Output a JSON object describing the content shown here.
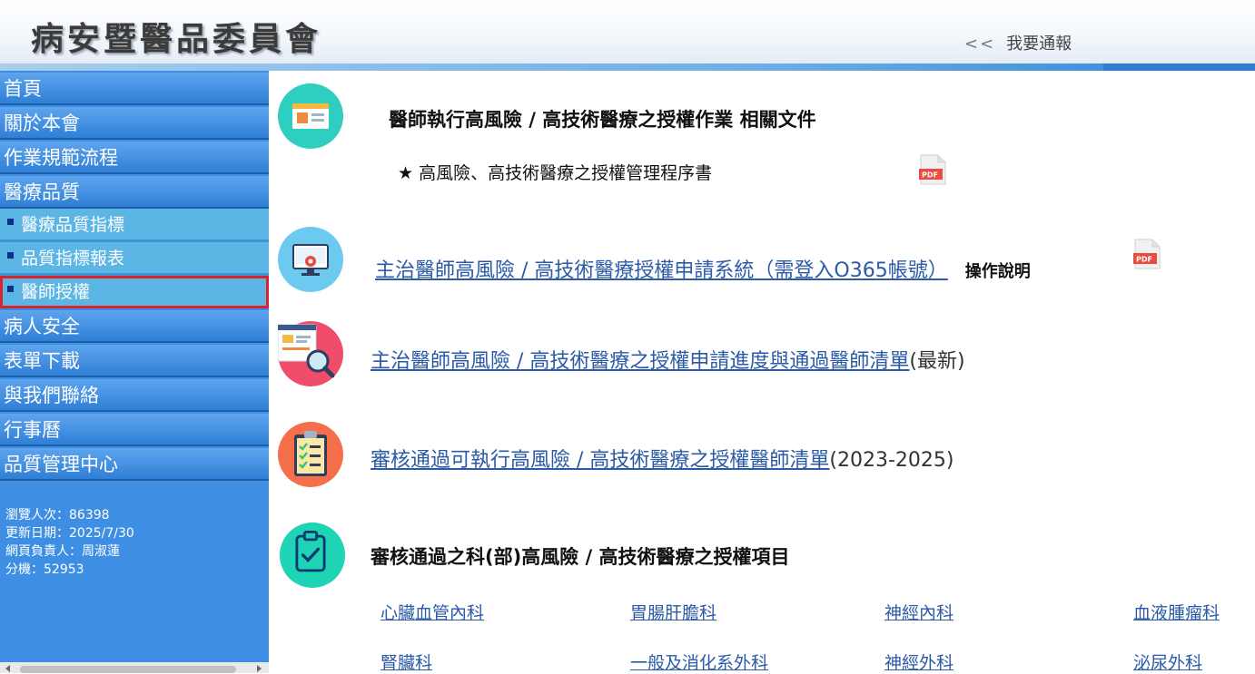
{
  "header": {
    "site_title": "病安暨醫品委員會",
    "report_arrows": "<<",
    "report_label": "我要通報"
  },
  "sidebar": {
    "items": [
      {
        "label": "首頁"
      },
      {
        "label": "關於本會"
      },
      {
        "label": "作業規範流程"
      },
      {
        "label": "醫療品質"
      }
    ],
    "subitems": [
      {
        "label": "醫療品質指標"
      },
      {
        "label": "品質指標報表"
      },
      {
        "label": "醫師授權",
        "active": true
      }
    ],
    "items_after": [
      {
        "label": "病人安全"
      },
      {
        "label": "表單下載"
      },
      {
        "label": "與我們聯絡"
      },
      {
        "label": "行事曆"
      },
      {
        "label": "品質管理中心"
      }
    ],
    "stats": {
      "views": "瀏覽人次：86398",
      "updated": "更新日期：2025/7/30",
      "owner": "網頁負責人：周淑蓮",
      "ext": "分機：52953"
    }
  },
  "main": {
    "section1": {
      "title": "醫師執行高風險 / 高技術醫療之授權作業 相關文件",
      "doc_star": "★",
      "doc_label": "高風險、高技術醫療之授權管理程序書"
    },
    "section2": {
      "link": "主治醫師高風險 / 高技術醫療授權申請系統（需登入O365帳號）",
      "extra": "操作說明"
    },
    "section3": {
      "link": "主治醫師高風險 / 高技術醫療之授權申請進度與通過醫師清單",
      "suffix": "(最新)"
    },
    "section4": {
      "link": "審核通過可執行高風險 / 高技術醫療之授權醫師清單",
      "suffix": "(2023-2025)"
    },
    "section5": {
      "title": "審核通過之科(部)高風險 / 高技術醫療之授權項目",
      "departments": [
        "心臟血管內科",
        "胃腸肝膽科",
        "神經內科",
        "血液腫瘤科",
        "腎臟科",
        "一般及消化系外科",
        "神經外科",
        "泌尿外科"
      ]
    },
    "pdf_label": "PDF"
  },
  "colors": {
    "sidebar": "#3e8fe3",
    "submenu": "#5bb5e5",
    "active_outline": "#d8242c",
    "link": "#2b5aa6"
  }
}
